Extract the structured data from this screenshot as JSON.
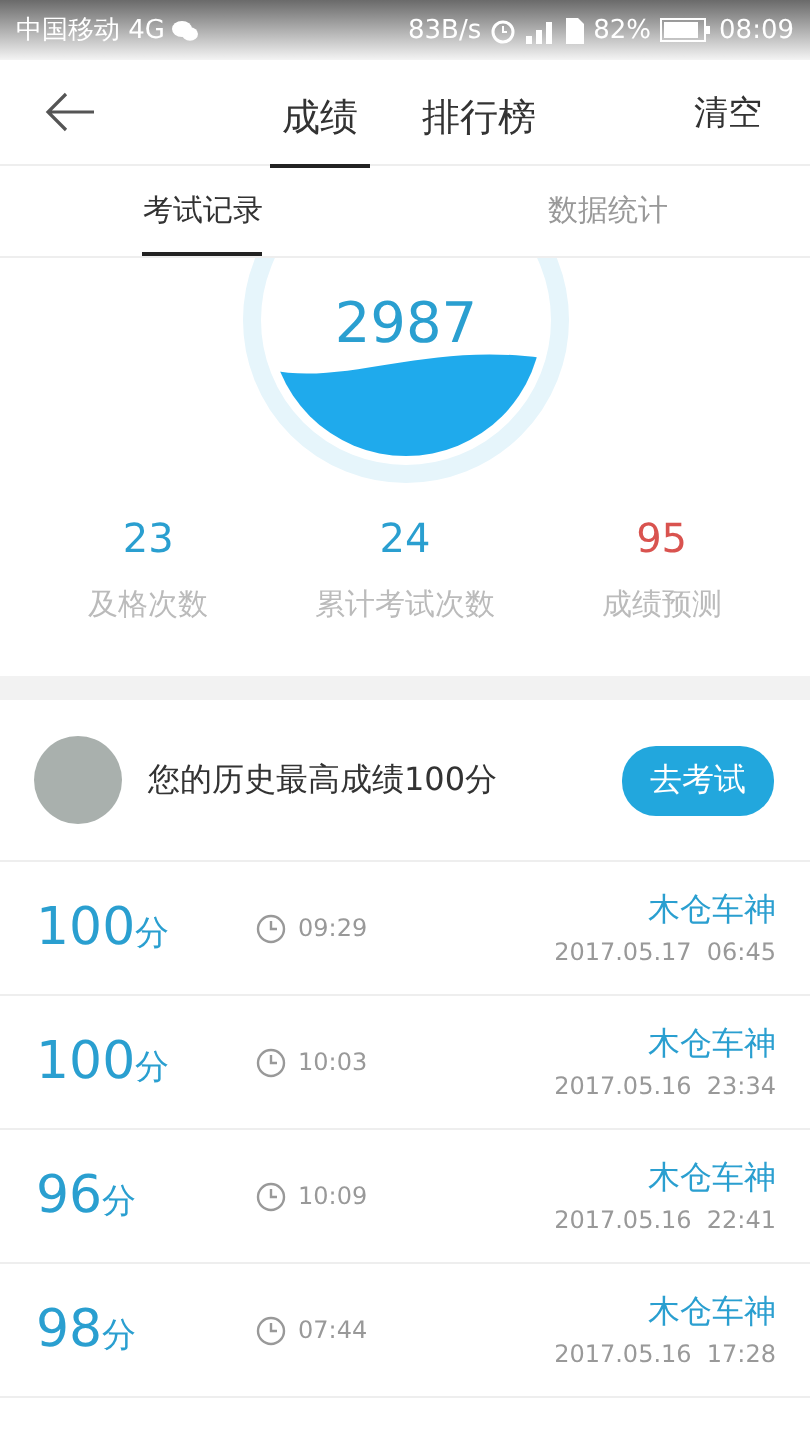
{
  "status_bar": {
    "carrier": "中国移动 4G",
    "speed": "83B/s",
    "battery": "82%",
    "time": "08:09"
  },
  "nav": {
    "tabs": [
      {
        "label": "成绩",
        "selected": true
      },
      {
        "label": "排行榜",
        "selected": false
      }
    ],
    "action": "清空"
  },
  "sub_tabs": [
    {
      "label": "考试记录",
      "selected": true
    },
    {
      "label": "数据统计",
      "selected": false
    }
  ],
  "gauge": {
    "value": "2987"
  },
  "stats": [
    {
      "value": "23",
      "label": "及格次数",
      "color": "#2a9fd0"
    },
    {
      "value": "24",
      "label": "累计考试次数",
      "color": "#2a9fd0"
    },
    {
      "value": "95",
      "label": "成绩预测",
      "color": "#d9534f"
    }
  ],
  "best": {
    "text": "您的历史最高成绩100分",
    "button": "去考试"
  },
  "records": [
    {
      "score": "100",
      "unit": "分",
      "duration": "09:29",
      "name": "木仓车神",
      "date": "2017.05.17  06:45"
    },
    {
      "score": "100",
      "unit": "分",
      "duration": "10:03",
      "name": "木仓车神",
      "date": "2017.05.16  23:34"
    },
    {
      "score": "96",
      "unit": "分",
      "duration": "10:09",
      "name": "木仓车神",
      "date": "2017.05.16  22:41"
    },
    {
      "score": "98",
      "unit": "分",
      "duration": "07:44",
      "name": "木仓车神",
      "date": "2017.05.16  17:28"
    }
  ]
}
